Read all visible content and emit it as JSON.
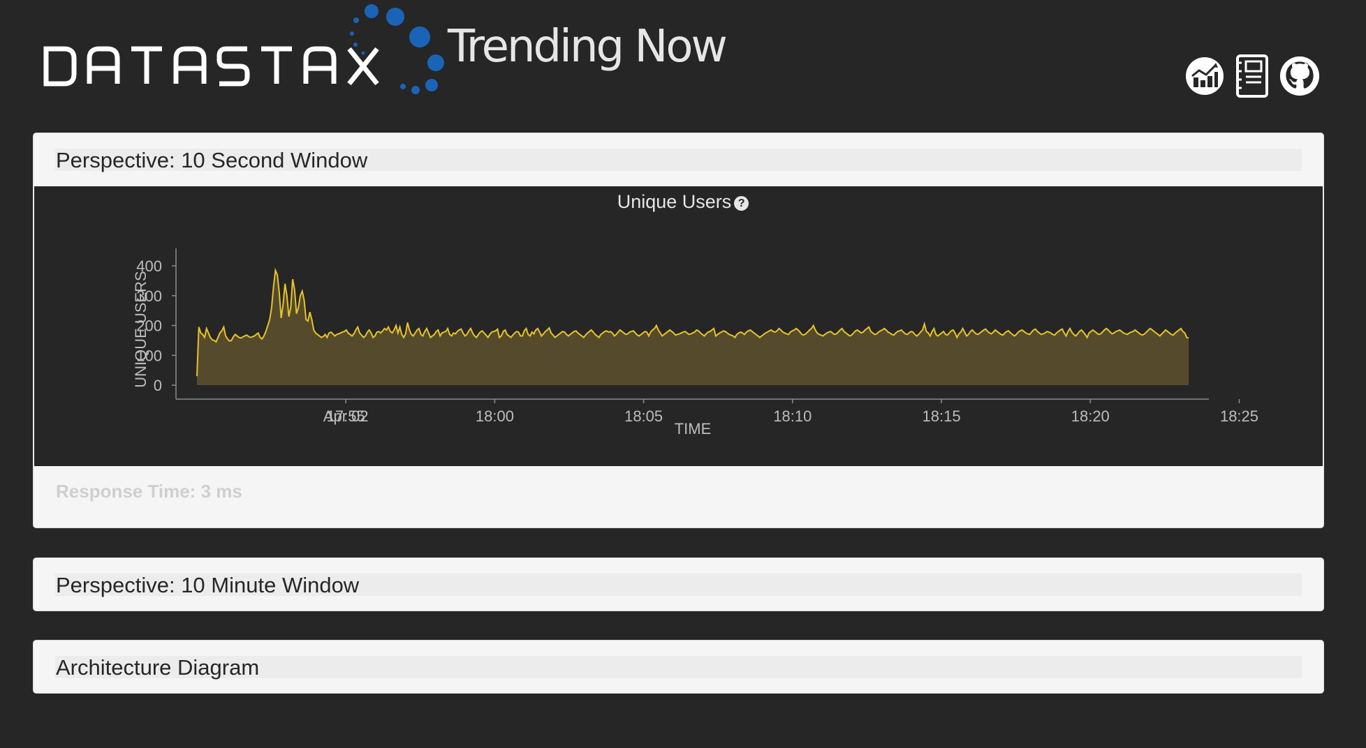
{
  "header": {
    "brand": "DATASTAX",
    "app_title": "Trending Now",
    "brand_colors": {
      "dots": "#1a64b8",
      "text": "#ffffff"
    },
    "icons": [
      {
        "name": "analytics-chart-icon"
      },
      {
        "name": "notebook-icon"
      },
      {
        "name": "github-icon"
      }
    ]
  },
  "panels": [
    {
      "title": "Perspective: 10 Second Window",
      "chart_title": "Unique Users",
      "response_time": "Response Time: 3 ms"
    },
    {
      "title": "Perspective: 10 Minute Window"
    },
    {
      "title": "Architecture Diagram"
    }
  ],
  "chart_data": {
    "type": "area",
    "title": "Unique Users",
    "xlabel": "TIME",
    "ylabel": "UNIQUE USERS",
    "ylim": [
      0,
      400
    ],
    "yticks": [
      0,
      100,
      200,
      300,
      400
    ],
    "xticks": [
      "Apr 02",
      "17:55",
      "18:00",
      "18:05",
      "18:10",
      "18:15",
      "18:20",
      "18:25"
    ],
    "xlim_minutes": [
      0,
      33.3
    ],
    "xtick_positions_minutes": [
      5,
      5,
      10,
      15,
      20,
      25,
      30,
      35
    ],
    "colors": {
      "line": "#e8c32a",
      "fill": "#554b2c"
    },
    "series": [
      {
        "values": [
          30,
          195,
          175,
          170,
          160,
          190,
          175,
          160,
          152,
          150,
          145,
          160,
          175,
          182,
          195,
          165,
          155,
          148,
          150,
          162,
          170,
          165,
          160,
          158,
          162,
          165,
          168,
          163,
          160,
          162,
          165,
          170,
          175,
          160,
          155,
          165,
          180,
          200,
          220,
          260,
          330,
          385,
          370,
          310,
          225,
          270,
          340,
          300,
          230,
          260,
          355,
          320,
          240,
          260,
          300,
          315,
          285,
          220,
          215,
          245,
          220,
          185,
          175,
          170,
          165,
          160,
          163,
          170,
          160,
          175,
          178,
          172,
          165,
          170,
          172,
          175,
          178,
          180,
          185,
          175,
          170,
          165,
          172,
          185,
          195,
          175,
          168,
          160,
          165,
          178,
          185,
          175,
          160,
          165,
          178,
          180,
          175,
          182,
          190,
          185,
          195,
          180,
          175,
          185,
          200,
          175,
          195,
          170,
          160,
          172,
          210,
          185,
          170,
          165,
          175,
          185,
          190,
          170,
          165,
          180,
          190,
          175,
          160,
          165,
          170,
          180,
          185,
          165,
          175,
          178,
          180,
          190,
          170,
          165,
          175,
          172,
          180,
          185,
          188,
          175,
          165,
          170,
          182,
          190,
          175,
          165,
          160,
          170,
          178,
          182,
          175,
          168,
          160,
          170,
          178,
          180,
          182,
          188,
          160,
          165,
          180,
          185,
          170,
          165,
          160,
          168,
          175,
          180,
          178,
          165,
          165,
          182,
          190,
          170,
          165,
          178,
          172,
          185,
          190,
          178,
          165,
          172,
          180,
          185,
          192,
          175,
          168,
          160,
          165,
          170,
          175,
          180,
          178,
          170,
          165,
          170,
          175,
          180,
          182,
          175,
          170,
          165,
          160,
          168,
          175,
          180,
          185,
          178,
          170,
          165,
          160,
          170,
          175,
          180,
          182,
          178,
          180,
          175,
          165,
          170,
          178,
          185,
          180,
          175,
          170,
          172,
          178,
          180,
          182,
          175,
          168,
          165,
          170,
          175,
          180,
          178,
          165,
          178,
          185,
          190,
          200,
          185,
          175,
          165,
          170,
          175,
          180,
          185,
          180,
          175,
          168,
          170,
          172,
          175,
          178,
          180,
          175,
          170,
          172,
          175,
          178,
          185,
          182,
          175,
          170,
          165,
          172,
          178,
          180,
          185,
          190,
          165,
          170,
          175,
          178,
          182,
          180,
          175,
          170,
          168,
          165,
          160,
          170,
          175,
          178,
          175,
          170,
          178,
          182,
          185,
          180,
          175,
          170,
          165,
          160,
          165,
          170,
          175,
          178,
          182,
          185,
          180,
          178,
          182,
          190,
          185,
          178,
          175,
          172,
          170,
          178,
          182,
          185,
          190,
          185,
          178,
          170,
          168,
          172,
          178,
          185,
          190,
          200,
          185,
          175,
          170,
          168,
          165,
          170,
          175,
          178,
          180,
          175,
          170,
          172,
          178,
          185,
          190,
          180,
          175,
          170,
          165,
          168,
          175,
          182,
          185,
          180,
          175,
          178,
          185,
          190,
          195,
          180,
          175,
          170,
          172,
          178,
          182,
          185,
          190,
          185,
          178,
          175,
          170,
          168,
          175,
          180,
          182,
          185,
          178,
          172,
          170,
          175,
          180,
          178,
          170,
          165,
          170,
          178,
          185,
          205,
          180,
          175,
          165,
          180,
          190,
          170,
          165,
          170,
          175,
          180,
          170,
          168,
          175,
          182,
          185,
          175,
          160,
          172,
          178,
          190,
          178,
          165,
          170,
          180,
          185,
          178,
          172,
          170,
          175,
          180,
          185,
          188,
          180,
          175,
          172,
          178,
          185,
          180,
          175,
          170,
          168,
          175,
          180,
          182,
          175,
          170,
          165,
          170,
          178,
          182,
          185,
          180,
          175,
          172,
          170,
          178,
          185,
          188,
          180,
          175,
          170,
          172,
          175,
          180,
          178,
          175,
          170,
          168,
          175,
          180,
          185,
          188,
          175,
          165,
          180,
          190,
          178,
          170,
          165,
          172,
          180,
          185,
          178,
          170,
          160,
          175,
          180,
          185,
          180,
          175,
          170,
          172,
          178,
          185,
          190,
          185,
          178,
          172,
          175,
          180,
          182,
          185,
          180,
          175,
          172,
          170,
          175,
          178,
          180,
          185,
          180,
          175,
          170,
          168,
          172,
          178,
          185,
          190,
          185,
          180,
          175,
          170,
          165,
          172,
          178,
          185,
          180,
          175,
          170,
          168,
          175,
          180,
          185,
          190,
          180,
          175,
          160,
          158
        ]
      }
    ]
  }
}
